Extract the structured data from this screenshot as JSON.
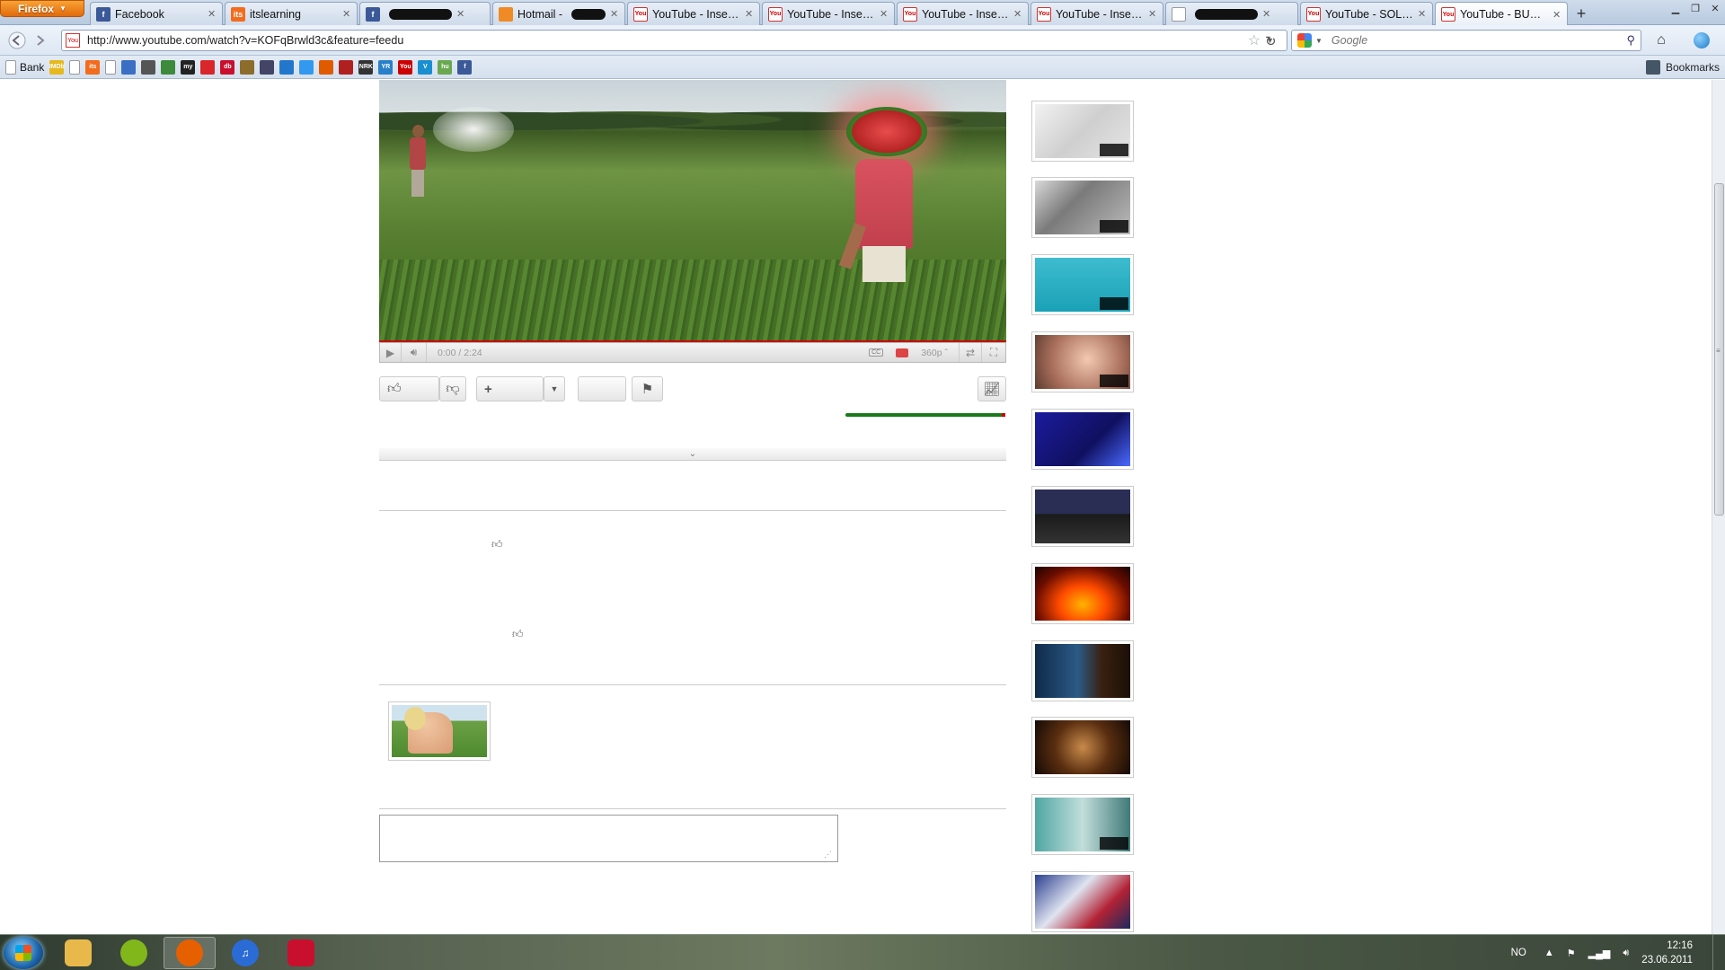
{
  "browser": {
    "menu_button": "Firefox",
    "tabs": [
      {
        "label": "Facebook",
        "favicon": "facebook-icon",
        "active": false
      },
      {
        "label": "itslearning",
        "favicon": "itslearning-icon",
        "active": false
      },
      {
        "label": "",
        "favicon": "facebook-icon",
        "active": false,
        "redacted": true
      },
      {
        "label": "Hotmail -",
        "favicon": "hotmail-icon",
        "active": false,
        "redacted": true
      },
      {
        "label": "YouTube - Insense...",
        "favicon": "youtube-icon",
        "active": false
      },
      {
        "label": "YouTube - Insense...",
        "favicon": "youtube-icon",
        "active": false
      },
      {
        "label": "YouTube - Insense...",
        "favicon": "youtube-icon",
        "active": false
      },
      {
        "label": "YouTube - Insense...",
        "favicon": "youtube-icon",
        "active": false
      },
      {
        "label": "",
        "favicon": "blank-page-icon",
        "active": false,
        "redacted": true
      },
      {
        "label": "YouTube - SOLAR...",
        "favicon": "youtube-icon",
        "active": false
      },
      {
        "label": "YouTube - BUBBL...",
        "favicon": "youtube-icon",
        "active": true
      }
    ],
    "new_tab": "+",
    "url": "http://www.youtube.com/watch?v=KOFqBrwld3c&feature=feedu",
    "search_placeholder": "Google",
    "bookmarks_bar": {
      "first_label": "Bank",
      "right_label": "Bookmarks"
    },
    "bookmark_icons": [
      {
        "name": "imdb-bookmark",
        "text": "IMDb",
        "color": "#e6b91e"
      },
      {
        "name": "blank-page-bookmark",
        "text": "",
        "color": "#ffffff"
      },
      {
        "name": "itslearning-bookmark",
        "text": "its",
        "color": "#f36b1c"
      },
      {
        "name": "blank-page-bookmark",
        "text": "",
        "color": "#ffffff"
      },
      {
        "name": "mail-bookmark",
        "text": "",
        "color": "#3a6fc4"
      },
      {
        "name": "car-bookmark",
        "text": "",
        "color": "#555555"
      },
      {
        "name": "puzzle-bookmark",
        "text": "",
        "color": "#3d8a3d"
      },
      {
        "name": "my-bookmark",
        "text": "my",
        "color": "#222222"
      },
      {
        "name": "vg-bookmark",
        "text": "",
        "color": "#d9262b"
      },
      {
        "name": "db-bookmark",
        "text": "db",
        "color": "#c8102e"
      },
      {
        "name": "music-bookmark",
        "text": "",
        "color": "#8c6d2c"
      },
      {
        "name": "game-bookmark",
        "text": "",
        "color": "#444466"
      },
      {
        "name": "globe-bookmark",
        "text": "",
        "color": "#2277cc"
      },
      {
        "name": "cloud-bookmark",
        "text": "",
        "color": "#3399ee"
      },
      {
        "name": "pinterest-bookmark",
        "text": "",
        "color": "#e05a00"
      },
      {
        "name": "guitar-bookmark",
        "text": "",
        "color": "#b02020"
      },
      {
        "name": "nrk-bookmark",
        "text": "NRK",
        "color": "#333333"
      },
      {
        "name": "yr-bookmark",
        "text": "YR",
        "color": "#2a7fc9"
      },
      {
        "name": "youtube-bookmark",
        "text": "You",
        "color": "#cc0000"
      },
      {
        "name": "vimeo-bookmark",
        "text": "V",
        "color": "#1a8fd0"
      },
      {
        "name": "hulu-bookmark",
        "text": "hu",
        "color": "#6aa84f"
      },
      {
        "name": "facebook-bookmark",
        "text": "f",
        "color": "#3b5998"
      }
    ]
  },
  "player": {
    "time": "0:00 / 2:24",
    "quality": "360p",
    "progress_fraction": 0.0
  },
  "like_ratio": {
    "likes_fraction": 0.98
  },
  "sidebar": {
    "thumbnails": [
      {
        "name": "related-video-1",
        "bg": "linear-gradient(135deg,#f2f2f2,#cfcfcf 50%,#e5e5e5)",
        "has_duration": true
      },
      {
        "name": "related-video-2",
        "bg": "linear-gradient(135deg,#d9d9d9,#7a7a7a 40%,#bcbcbc)",
        "has_duration": true
      },
      {
        "name": "related-video-3",
        "bg": "linear-gradient(#3ebccf,#1aa1b6)",
        "has_duration": true
      },
      {
        "name": "related-video-4",
        "bg": "radial-gradient(circle at 55% 45%,#f3c9b1,#a86e5b 60%,#5c3b2f)",
        "has_duration": true
      },
      {
        "name": "related-video-5",
        "bg": "linear-gradient(135deg,#1b1b9e,#101060 60%,#4a6aff)",
        "has_duration": false
      },
      {
        "name": "related-video-6",
        "bg": "linear-gradient(#2a2e55 0 45%,#1a1a1a 46%,#333 100%)",
        "has_duration": false
      },
      {
        "name": "related-video-7",
        "bg": "radial-gradient(ellipse at 50% 70%,#ffb400,#ff4a00 35%,#6b0d00 70%,#1a0300)",
        "has_duration": false
      },
      {
        "name": "related-video-8",
        "bg": "linear-gradient(90deg,#0f2a4a,#2b5a86 45%,#3a2010 70%,#1a0f06)",
        "has_duration": false
      },
      {
        "name": "related-video-9",
        "bg": "radial-gradient(circle at 50% 50%,#c88a4a,#5a2e10 50%,#140a05)",
        "has_duration": false
      },
      {
        "name": "related-video-10",
        "bg": "linear-gradient(90deg,#4fa6a3,#c2dedb 50%,#3f7a78)",
        "has_duration": true
      },
      {
        "name": "related-video-11",
        "bg": "linear-gradient(135deg,#2b3f8f,#dfe3f0 40%,#b22234 70%,#1b2a5e)",
        "has_duration": false
      }
    ]
  },
  "taskbar": {
    "language": "NO",
    "time": "12:16",
    "date": "23.06.2011",
    "apps": [
      {
        "name": "explorer-app",
        "color": "#e9b84a",
        "label": ""
      },
      {
        "name": "spotify-app",
        "color": "#81b71a",
        "label": ""
      },
      {
        "name": "firefox-app",
        "color": "#e66000",
        "label": ""
      },
      {
        "name": "itunes-app",
        "color": "#2b6bd6",
        "label": "♫"
      },
      {
        "name": "acrobat-app",
        "color": "#c8102e",
        "label": ""
      }
    ]
  }
}
